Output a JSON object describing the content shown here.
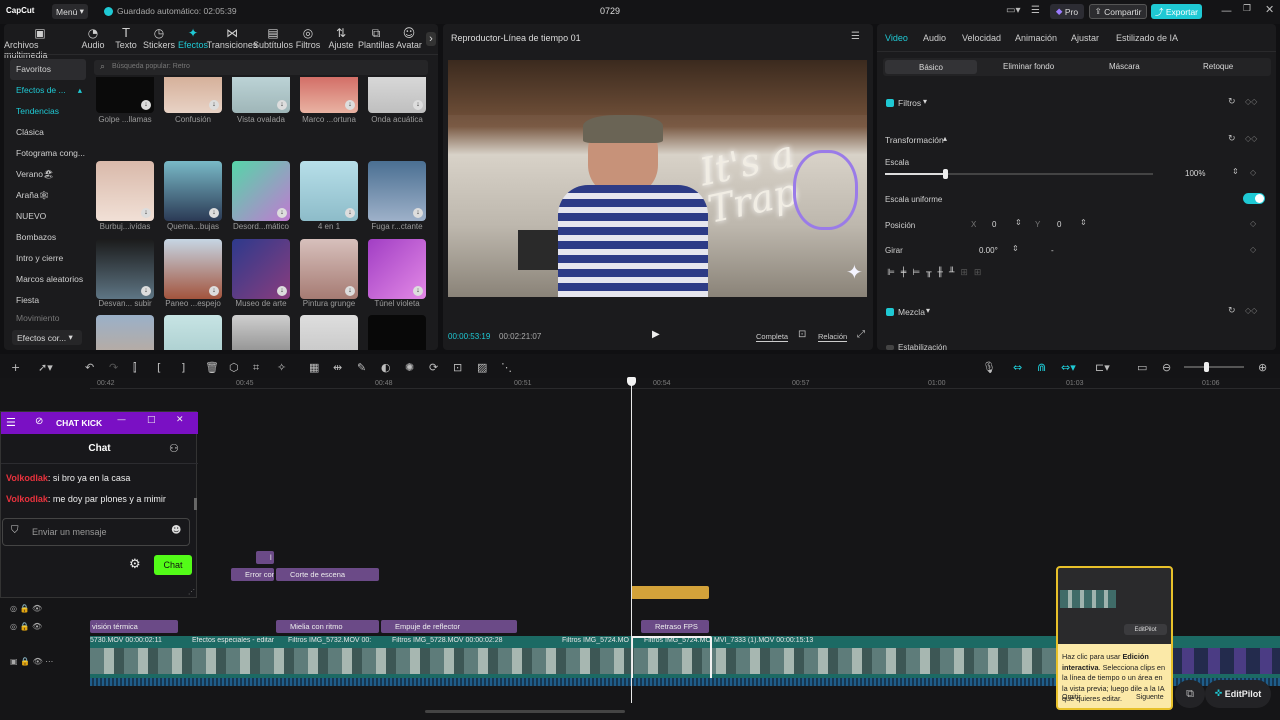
{
  "app": {
    "logo": "CapCut",
    "menu": "Menú",
    "autosave": "Guardado automático: 02:05:39",
    "project": "0729",
    "pro": "Pro",
    "share": "Compartir",
    "export": "Exportar"
  },
  "toolbar": [
    {
      "label": "Archivos multimedia",
      "icon": "media-icon"
    },
    {
      "label": "Audio",
      "icon": "audio-icon"
    },
    {
      "label": "Texto",
      "icon": "text-icon"
    },
    {
      "label": "Stickers",
      "icon": "sticker-icon"
    },
    {
      "label": "Efectos",
      "icon": "effects-icon",
      "active": true
    },
    {
      "label": "Transiciones",
      "icon": "transition-icon"
    },
    {
      "label": "Subtítulos",
      "icon": "subtitle-icon"
    },
    {
      "label": "Filtros",
      "icon": "filter-icon"
    },
    {
      "label": "Ajuste",
      "icon": "adjust-icon"
    },
    {
      "label": "Plantillas",
      "icon": "template-icon"
    },
    {
      "label": "Avatar",
      "icon": "avatar-icon"
    }
  ],
  "sidebar": {
    "items": [
      "Favoritos",
      "Efectos de ...",
      "Tendencias",
      "Clásica",
      "Fotograma cong...",
      "Verano🏖",
      "Araña🕸",
      "NUEVO",
      "Bombazos",
      "Intro y cierre",
      "Marcos aleatorios",
      "Fiesta",
      "Movimiento"
    ],
    "bottom": "Efectos cor..."
  },
  "search": {
    "placeholder": "Búsqueda popular: Retro"
  },
  "effects": {
    "row1": [
      "Golpe ...llamas",
      "Confusión",
      "Vista ovalada",
      "Marco ...ortuna",
      "Onda acuática"
    ],
    "row2": [
      "Burbuj...ivídas",
      "Quema...bujas",
      "Desord...mático",
      "4 en 1",
      "Fuga r...ctante"
    ],
    "row3": [
      "Desvan... subir",
      "Paneo ...espejo",
      "Museo de arte",
      "Pintura grunge",
      "Túnel violeta"
    ]
  },
  "player": {
    "title": "Reproductor-Línea de tiempo 01",
    "current": "00:00:53:19",
    "total": "00:02:21:07",
    "full": "Completa",
    "ratio": "Relación",
    "overlay_text": "It's a Trap"
  },
  "props": {
    "tabs": [
      "Video",
      "Audio",
      "Velocidad",
      "Animación",
      "Ajustar",
      "Estilizado de IA"
    ],
    "subtabs": [
      "Básico",
      "Eliminar fondo",
      "Máscara",
      "Retoque"
    ],
    "filters": "Filtros",
    "transform": "Transformación",
    "scale": "Escala",
    "scale_val": "100%",
    "uniform": "Escala uniforme",
    "position": "Posición",
    "x_label": "X",
    "x_val": "0",
    "y_label": "Y",
    "y_val": "0",
    "rotate": "Girar",
    "rotate_val": "0.00°",
    "rotate_dash": "-",
    "blend": "Mezcla",
    "stabilize": "Estabilización"
  },
  "timeline": {
    "ticks": [
      "00:42",
      "00:45",
      "00:48",
      "00:51",
      "00:54",
      "00:57",
      "01:00",
      "01:03",
      "01:06"
    ],
    "chips": {
      "error": "Error con",
      "corte": "Corte de escena",
      "vision": "visión térmica",
      "mielia": "Mielia con ritmo",
      "empuje": "Empuje de reflector",
      "retraso": "Retraso FPS",
      "small": "l"
    },
    "clips": [
      "5730.MOV  00:00:02:11",
      "Efectos especiales - editar",
      "Filtros  IMG_5732.MOV  00:",
      "Filtros  IMG_5728.MOV  00:00:02:28",
      "Filtros  IMG_5724.MO",
      "Filtros  IMG_5724.MO",
      "MVI_7333 (1).MOV  00:00:15:13"
    ]
  },
  "chat": {
    "title": "CHAT KICK",
    "header": "Chat",
    "messages": [
      {
        "user": "Volkodlak",
        "text": ": si bro ya en la casa"
      },
      {
        "user": "Volkodlak",
        "text": ": me doy par plones y a mimir"
      }
    ],
    "placeholder": "Enviar un mensaje",
    "send": "Chat"
  },
  "tip": {
    "prefix": "Haz clic para usar ",
    "bold": "Edición interactiva",
    "rest": ". Selecciona clips en la línea de tiempo o un área en la vista previa; luego dile a la IA qué quieres editar.",
    "omit": "Omitir",
    "next": "Siguente",
    "brand": "EditPilot"
  },
  "editpilot": "EditPilot",
  "colors": {
    "accent": "#1fc9d4",
    "chat": "#53fc18",
    "chip": "#6b4a87",
    "main_track": "#1c6a64",
    "yellow": "#e8c12a"
  }
}
